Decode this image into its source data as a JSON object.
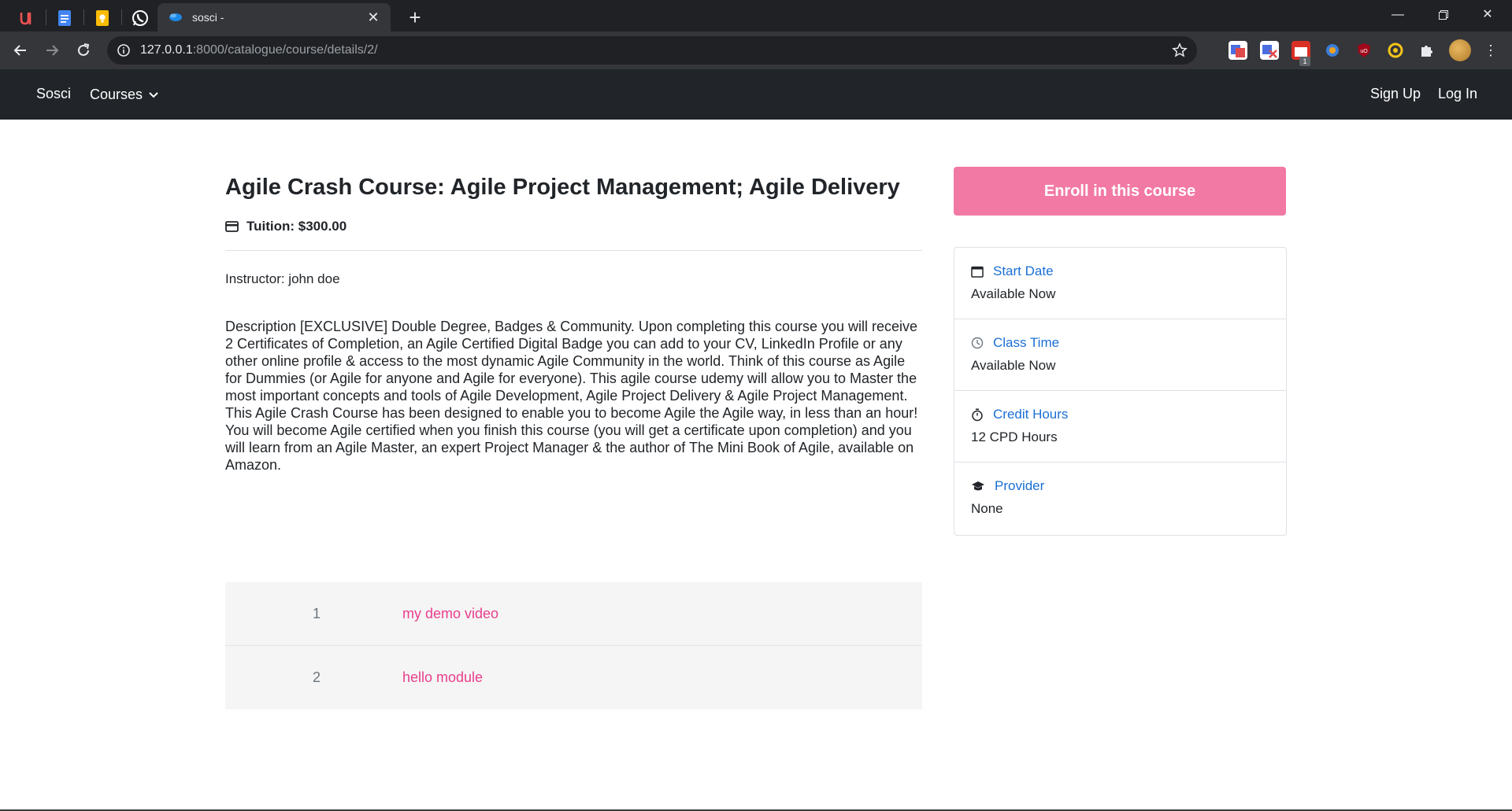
{
  "browser": {
    "pinned_tabs": [
      "udemy-icon",
      "docs-icon",
      "keep-icon",
      "whatsapp-icon"
    ],
    "active_tab_title": "sosci -",
    "url_host": "127.0.0.1",
    "url_path": ":8000/catalogue/course/details/2/",
    "extension_badge": "1"
  },
  "navbar": {
    "brand": "Sosci",
    "courses": "Courses",
    "signup": "Sign Up",
    "login": "Log In"
  },
  "course": {
    "title": "Agile Crash Course: Agile Project Management; Agile Delivery",
    "tuition": "Tuition: $300.00",
    "instructor": "Instructor: john doe",
    "description": "Description [EXCLUSIVE] Double Degree, Badges & Community. Upon completing this course you will receive 2 Certificates of Completion, an Agile Certified Digital Badge you can add to your CV, LinkedIn Profile or any other online profile & access to the most dynamic Agile Community in the world. Think of this course as Agile for Dummies (or Agile for anyone and Agile for everyone). This agile course udemy will allow you to Master the most important concepts and tools of Agile Development, Agile Project Delivery & Agile Project Management. This Agile Crash Course has been designed to enable you to become Agile the Agile way, in less than an hour! You will become Agile certified when you finish this course (you will get a certificate upon completion) and you will learn from an Agile Master, an expert Project Manager & the author of The Mini Book of Agile, available on Amazon."
  },
  "modules": [
    {
      "number": "1",
      "title": "my demo video"
    },
    {
      "number": "2",
      "title": "hello module"
    }
  ],
  "sidebar": {
    "enroll_label": "Enroll in this course",
    "items": [
      {
        "label": "Start Date",
        "value": "Available Now",
        "icon": "calendar-icon"
      },
      {
        "label": "Class Time",
        "value": "Available Now",
        "icon": "clock-icon"
      },
      {
        "label": "Credit Hours",
        "value": "12 CPD Hours",
        "icon": "stopwatch-icon"
      },
      {
        "label": "Provider",
        "value": "None",
        "icon": "graduation-cap-icon"
      }
    ]
  },
  "colors": {
    "navbar_bg": "#212529",
    "accent_pink": "#f279a3",
    "link_pink": "#e83e8c",
    "info_blue": "#1a6fd4"
  }
}
